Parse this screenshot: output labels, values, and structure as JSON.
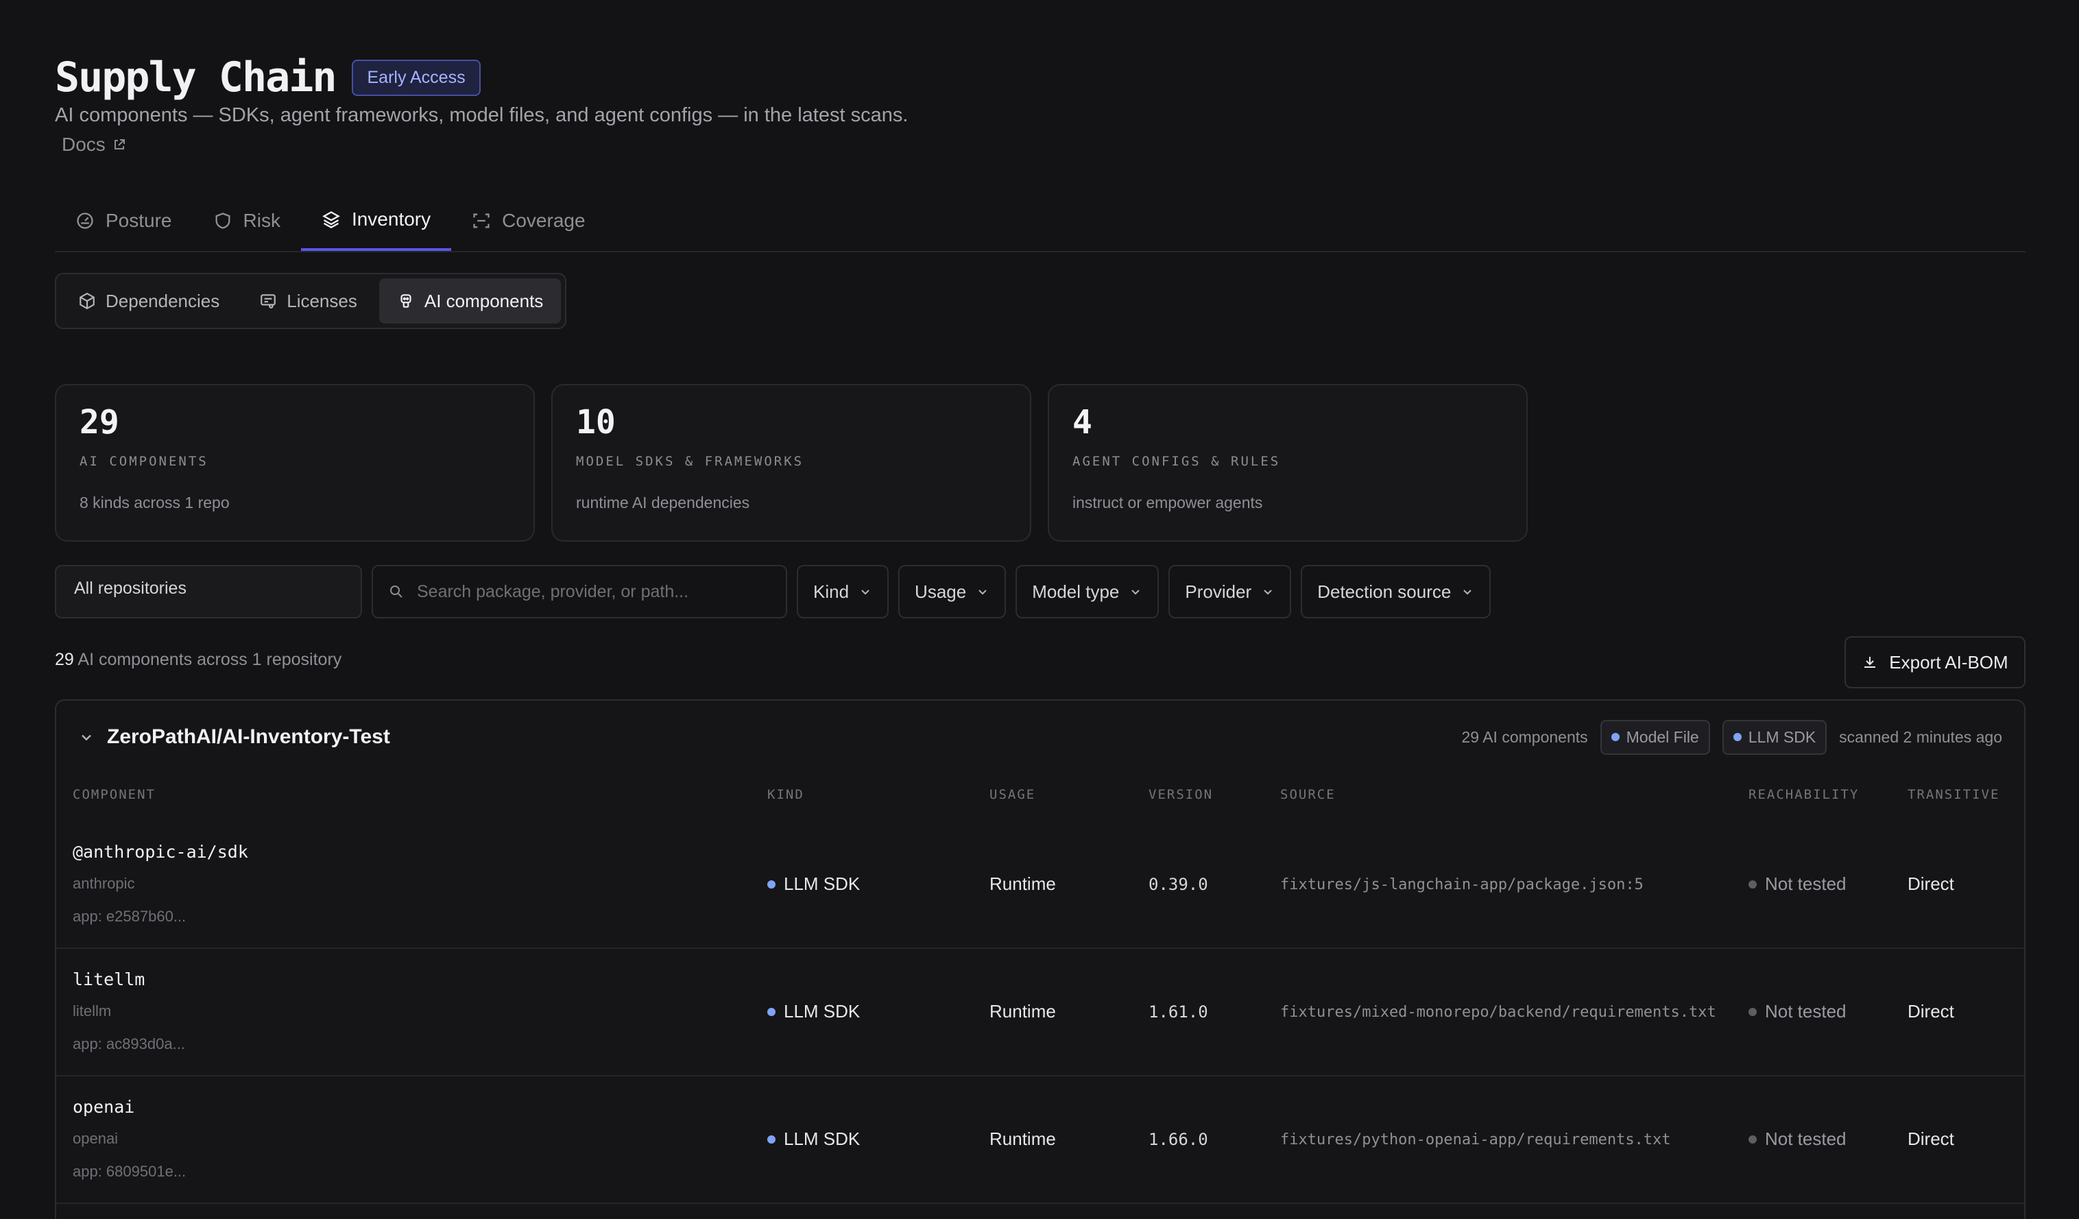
{
  "header": {
    "title": "Supply Chain",
    "badge": "Early Access",
    "subtitle": "AI components — SDKs, agent frameworks, model files, and agent configs — in the latest scans.",
    "docs_label": "Docs"
  },
  "tabs": [
    {
      "label": "Posture",
      "icon": "gauge-icon"
    },
    {
      "label": "Risk",
      "icon": "shield-icon"
    },
    {
      "label": "Inventory",
      "icon": "layers-icon",
      "active": true
    },
    {
      "label": "Coverage",
      "icon": "scan-icon"
    }
  ],
  "subtabs": [
    {
      "label": "Dependencies",
      "icon": "package-icon"
    },
    {
      "label": "Licenses",
      "icon": "license-icon"
    },
    {
      "label": "AI components",
      "icon": "robot-icon",
      "active": true
    }
  ],
  "cards": [
    {
      "value": "29",
      "label": "AI COMPONENTS",
      "desc": "8 kinds across 1 repo"
    },
    {
      "value": "10",
      "label": "MODEL SDKS & FRAMEWORKS",
      "desc": "runtime AI dependencies"
    },
    {
      "value": "4",
      "label": "AGENT CONFIGS & RULES",
      "desc": "instruct or empower agents"
    }
  ],
  "filters": {
    "repo": "All repositories",
    "search_placeholder": "Search package, provider, or path...",
    "kind": "Kind",
    "usage": "Usage",
    "model_type": "Model type",
    "provider": "Provider",
    "detection_source": "Detection source"
  },
  "summary": {
    "count": "29",
    "text": "AI components across 1 repository"
  },
  "export_label": "Export AI-BOM",
  "repo": {
    "name": "ZeroPathAI/AI-Inventory-Test",
    "count_text": "29 AI components",
    "chips": [
      "Model File",
      "LLM SDK"
    ],
    "scanned": "scanned 2 minutes ago"
  },
  "columns": [
    "COMPONENT",
    "KIND",
    "USAGE",
    "VERSION",
    "SOURCE",
    "REACHABILITY",
    "TRANSITIVE"
  ],
  "rows": [
    {
      "name": "@anthropic-ai/sdk",
      "provider": "anthropic",
      "app": "app: e2587b60...",
      "kind": "LLM SDK",
      "usage": "Runtime",
      "version": "0.39.0",
      "source": "fixtures/js-langchain-app/package.json:5",
      "reachability": "Not tested",
      "transitive": "Direct"
    },
    {
      "name": "litellm",
      "provider": "litellm",
      "app": "app: ac893d0a...",
      "kind": "LLM SDK",
      "usage": "Runtime",
      "version": "1.61.0",
      "source": "fixtures/mixed-monorepo/backend/requirements.txt",
      "reachability": "Not tested",
      "transitive": "Direct"
    },
    {
      "name": "openai",
      "provider": "openai",
      "app": "app: 6809501e...",
      "kind": "LLM SDK",
      "usage": "Runtime",
      "version": "1.66.0",
      "source": "fixtures/python-openai-app/requirements.txt",
      "reachability": "Not tested",
      "transitive": "Direct"
    }
  ]
}
